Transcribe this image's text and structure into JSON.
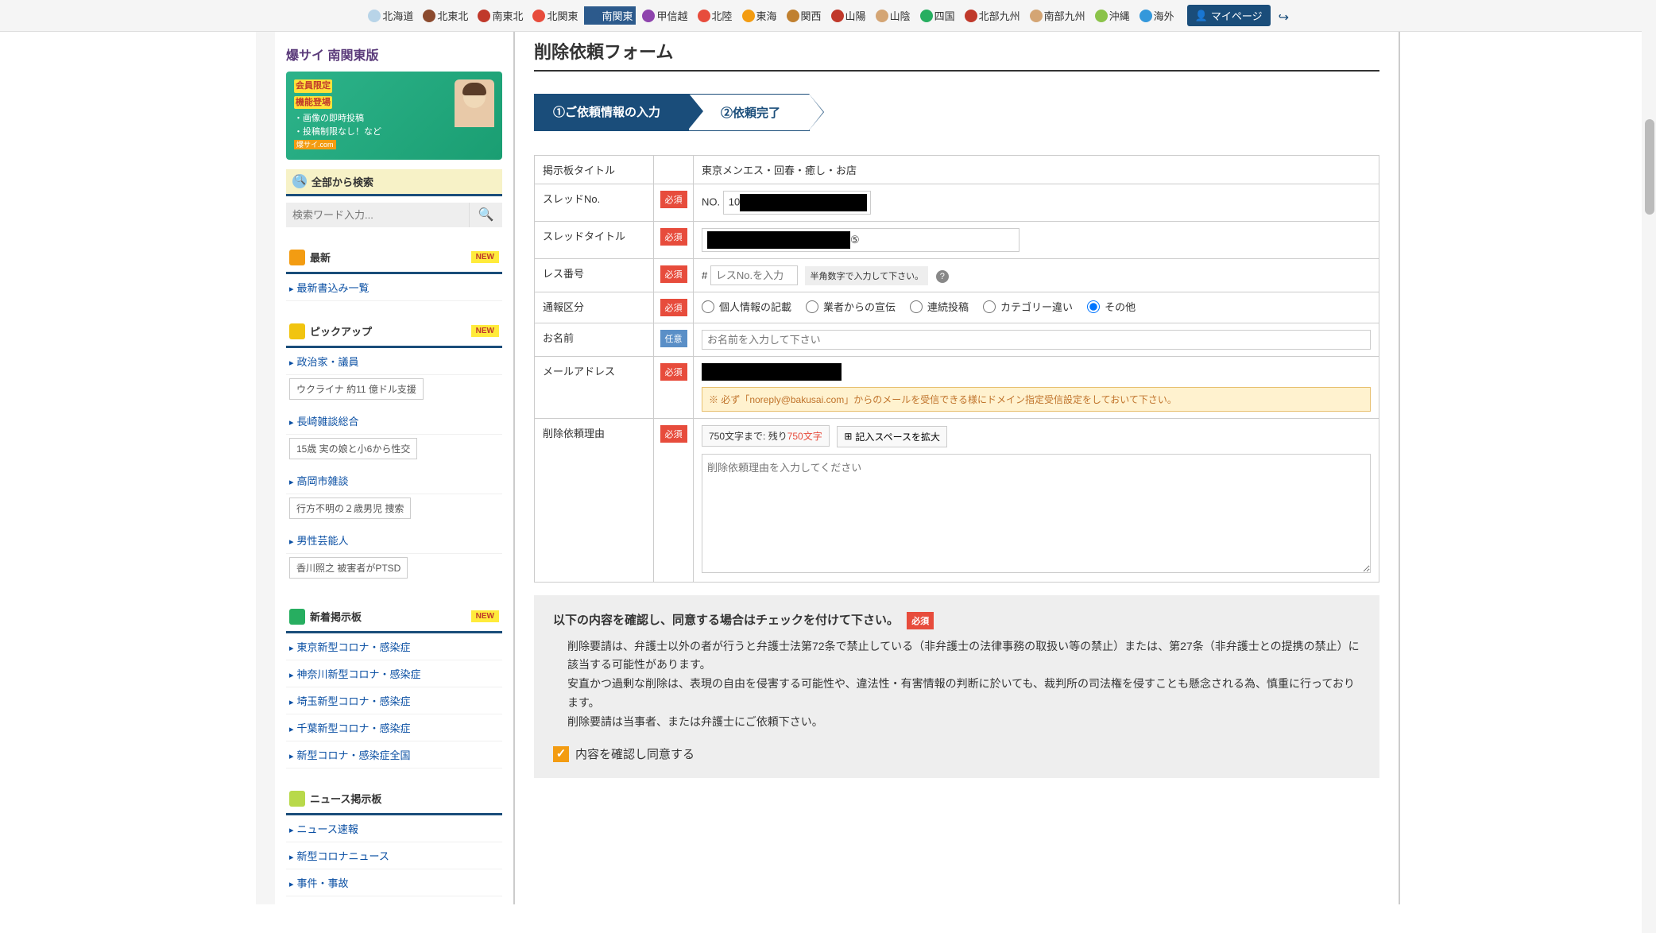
{
  "topbar": {
    "regions": [
      {
        "label": "北海道",
        "icon": "#b8d4e8"
      },
      {
        "label": "北東北",
        "icon": "#8b4a2e"
      },
      {
        "label": "南東北",
        "icon": "#c0392b"
      },
      {
        "label": "北関東",
        "icon": "#e74c3c"
      },
      {
        "label": "南関東",
        "icon": "#2c5a8c",
        "active": true
      },
      {
        "label": "甲信越",
        "icon": "#8e44ad"
      },
      {
        "label": "北陸",
        "icon": "#e74c3c"
      },
      {
        "label": "東海",
        "icon": "#f39c12"
      },
      {
        "label": "関西",
        "icon": "#c08030"
      },
      {
        "label": "山陽",
        "icon": "#c0392b"
      },
      {
        "label": "山陰",
        "icon": "#d4a574"
      },
      {
        "label": "四国",
        "icon": "#27ae60"
      },
      {
        "label": "北部九州",
        "icon": "#c0392b"
      },
      {
        "label": "南部九州",
        "icon": "#d4a574"
      },
      {
        "label": "沖縄",
        "icon": "#8bc34a"
      },
      {
        "label": "海外",
        "icon": "#3498db"
      }
    ],
    "mypage": "マイページ"
  },
  "sidebar": {
    "site_title": "爆サイ 南関東版",
    "promo": {
      "line1": "会員限定",
      "line2": "機能登場",
      "feat1": "・画像の即時投稿",
      "feat2": "・投稿制限なし！など",
      "tag": "爆サイ.com"
    },
    "search": {
      "head": "全部から検索",
      "placeholder": "検索ワード入力...",
      "btn": "🔍"
    },
    "latest": {
      "head": "最新",
      "badge": "NEW",
      "link": "最新書込み一覧"
    },
    "pickup": {
      "head": "ピックアップ",
      "badge": "NEW",
      "items": [
        {
          "link": "政治家・議員",
          "sub": "ウクライナ 約11 億ドル支援"
        },
        {
          "link": "長崎雑談総合",
          "sub": "15歳 実の娘と小6から性交"
        },
        {
          "link": "高岡市雑談",
          "sub": "行方不明の２歳男児 捜索"
        },
        {
          "link": "男性芸能人",
          "sub": "香川照之 被害者がPTSD"
        }
      ]
    },
    "newboard": {
      "head": "新着掲示板",
      "badge": "NEW",
      "items": [
        "東京新型コロナ・感染症",
        "神奈川新型コロナ・感染症",
        "埼玉新型コロナ・感染症",
        "千葉新型コロナ・感染症",
        "新型コロナ・感染症全国"
      ]
    },
    "news": {
      "head": "ニュース掲示板",
      "items": [
        "ニュース速報",
        "新型コロナニュース",
        "事件・事故"
      ]
    }
  },
  "form": {
    "title": "削除依頼フォーム",
    "step1": "①ご依頼情報の入力",
    "step2": "②依頼完了",
    "labels": {
      "board": "掲示板タイトル",
      "thread_no": "スレッドNo.",
      "thread_title": "スレッドタイトル",
      "res_no": "レス番号",
      "category": "通報区分",
      "name": "お名前",
      "email": "メールアドレス",
      "reason": "削除依頼理由",
      "badge_req": "必須",
      "badge_opt": "任意"
    },
    "values": {
      "board": "東京メンエス・回春・癒し・お店",
      "thread_no_prefix": "NO.",
      "thread_no_visible": "10",
      "thread_title_suffix": " ⑤",
      "res_prefix": "#",
      "res_placeholder": "レスNo.を入力",
      "res_hint": "半角数字で入力して下さい。",
      "name_placeholder": "お名前を入力して下さい",
      "email_note": "※ 必ず「noreply@bakusai.com」からのメールを受信できる様にドメイン指定受信設定をしておいて下さい。",
      "char_prefix": "750文字まで: 残り",
      "char_remain": "750文字",
      "expand": "記入スペースを拡大",
      "reason_placeholder": "削除依頼理由を入力してください"
    },
    "radios": [
      "個人情報の記載",
      "業者からの宣伝",
      "連続投稿",
      "カテゴリー違い",
      "その他"
    ],
    "radio_selected": 4
  },
  "agree": {
    "head": "以下の内容を確認し、同意する場合はチェックを付けて下さい。",
    "badge": "必須",
    "p1": "削除要請は、弁護士以外の者が行うと弁護士法第72条で禁止している（非弁護士の法律事務の取扱い等の禁止）または、第27条（非弁護士との提携の禁止）に該当する可能性があります。",
    "p2": "安直かつ過剰な削除は、表現の自由を侵害する可能性や、違法性・有害情報の判断に於いても、裁判所の司法権を侵すことも懸念される為、慎重に行っております。",
    "p3": "削除要請は当事者、または弁護士にご依頼下さい。",
    "check": "内容を確認し同意する"
  }
}
